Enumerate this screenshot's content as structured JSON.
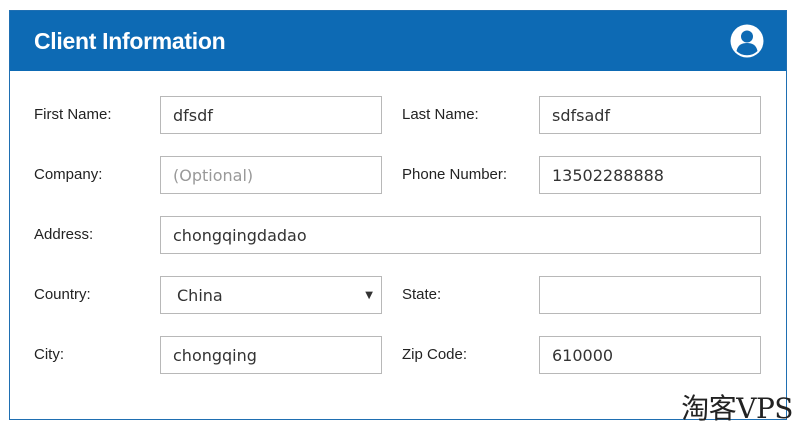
{
  "header": {
    "title": "Client Information",
    "icon": "user-circle-icon",
    "accent_color": "#0d6ab4"
  },
  "form": {
    "first_name": {
      "label": "First Name:",
      "value": "dfsdf"
    },
    "last_name": {
      "label": "Last Name:",
      "value": "sdfsadf"
    },
    "company": {
      "label": "Company:",
      "value": "",
      "placeholder": "(Optional)"
    },
    "phone": {
      "label": "Phone Number:",
      "value": "13502288888"
    },
    "address": {
      "label": "Address:",
      "value": "chongqingdadao"
    },
    "country": {
      "label": "Country:",
      "value": "China"
    },
    "state": {
      "label": "State:",
      "value": ""
    },
    "city": {
      "label": "City:",
      "value": "chongqing"
    },
    "zip": {
      "label": "Zip Code:",
      "value": "610000"
    }
  },
  "watermark": "淘客VPS"
}
